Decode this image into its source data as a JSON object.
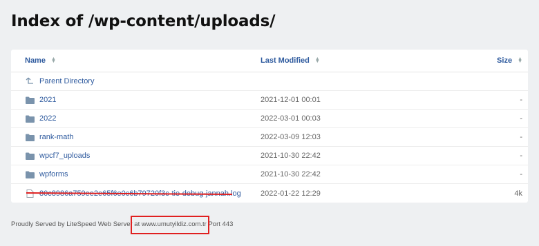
{
  "page": {
    "title": "Index of /wp-content/uploads/"
  },
  "table": {
    "headers": {
      "name": "Name",
      "last_modified": "Last Modified",
      "size": "Size"
    },
    "parent": {
      "label": "Parent Directory",
      "icon": "up-arrow-icon"
    },
    "rows": [
      {
        "name": "2021",
        "modified": "2021-12-01 00:01",
        "size": "-",
        "icon": "folder-icon"
      },
      {
        "name": "2022",
        "modified": "2022-03-01 00:03",
        "size": "-",
        "icon": "folder-icon"
      },
      {
        "name": "rank-math",
        "modified": "2022-03-09 12:03",
        "size": "-",
        "icon": "folder-icon"
      },
      {
        "name": "wpcf7_uploads",
        "modified": "2021-10-30 22:42",
        "size": "-",
        "icon": "folder-icon"
      },
      {
        "name": "wpforms",
        "modified": "2021-10-30 22:42",
        "size": "-",
        "icon": "folder-icon"
      },
      {
        "name": "80c8986a759ee2e65f6e0c6b79720f3c-tie-debug-jannah.log",
        "modified": "2022-01-22 12:29",
        "size": "4k",
        "icon": "file-icon"
      }
    ]
  },
  "footer": {
    "text": "Proudly Served by LiteSpeed Web Server at www.umutyildiz.com.tr Port 443"
  },
  "colors": {
    "link": "#2e5a9e",
    "folder": "#7a93ac",
    "annotation": "#e02020",
    "background": "#eef0f2"
  }
}
